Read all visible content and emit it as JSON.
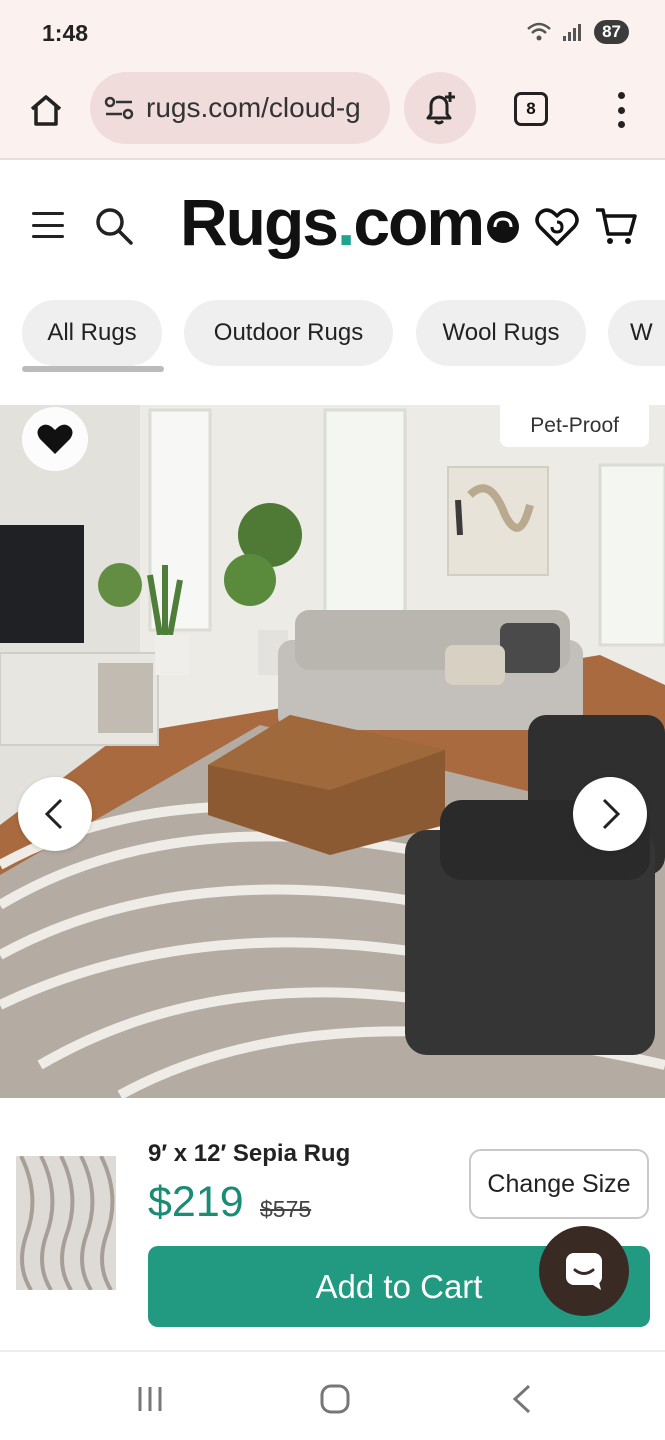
{
  "status_bar": {
    "time": "1:48",
    "battery": "87"
  },
  "browser": {
    "url": "rugs.com/cloud-g",
    "tab_count": "8"
  },
  "header": {
    "logo_text": "Rugs",
    "logo_dot": ".",
    "logo_suffix": "com"
  },
  "categories": [
    "All Rugs",
    "Outdoor Rugs",
    "Wool Rugs",
    "W"
  ],
  "hero": {
    "badge": "Pet-Proof"
  },
  "product": {
    "title": "9′ x 12′ Sepia Rug",
    "price": "$219",
    "original_price": "$575",
    "change_size_label": "Change Size",
    "add_to_cart_label": "Add to Cart"
  },
  "colors": {
    "accent": "#229a82",
    "price": "#1a8c74",
    "logo_dot": "#1fa58e",
    "browser_bg": "#fbf1ee"
  }
}
